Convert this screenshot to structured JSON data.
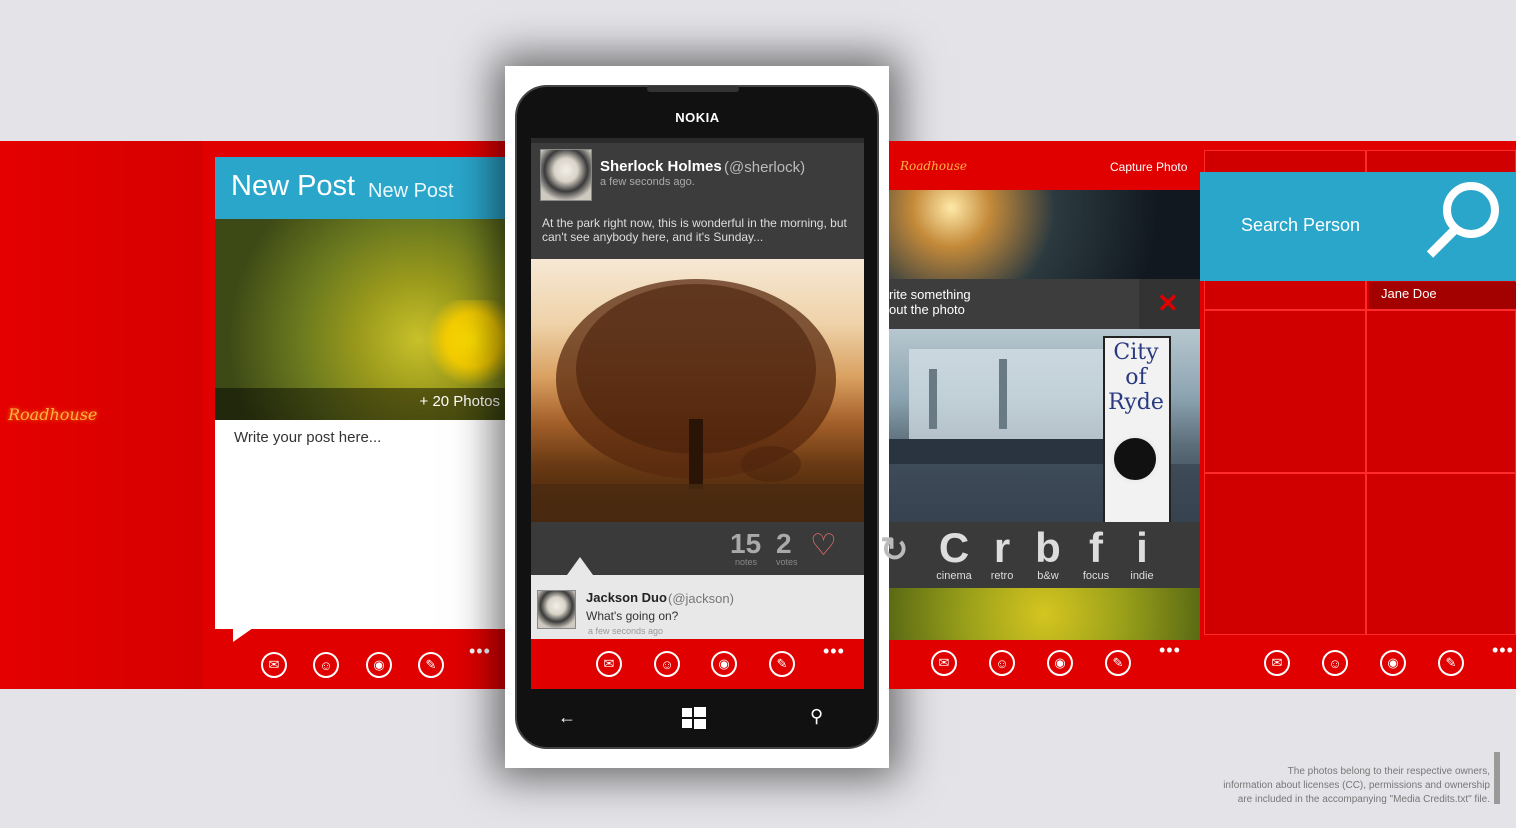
{
  "brand": {
    "logo_text": "Roadhouse",
    "accent_color": "#e00000",
    "secondary_color": "#2aa6cb"
  },
  "new_post": {
    "title": "New Post",
    "subtitle": "New Post",
    "photo_count": "+ 20 Photos",
    "placeholder": "Write your post here..."
  },
  "phone": {
    "brand": "NOKIA",
    "post": {
      "name": "Sherlock Holmes",
      "handle": "(@sherlock)",
      "time": "a few seconds ago.",
      "text": "At the park right now, this is wonderful in the morning, but can't see anybody here, and it's Sunday..."
    },
    "stats": {
      "notes_count": "15",
      "notes_label": "notes",
      "votes_count": "2",
      "votes_label": "votes"
    },
    "comment": {
      "name": "Jackson Duo",
      "handle": "(@jackson)",
      "text": "What's going on?",
      "time": "a few seconds ago"
    }
  },
  "capture": {
    "logo": "Roadhouse",
    "title": "Capture Photo",
    "caption_line1": "rite something",
    "caption_line2": "out the photo",
    "sign_text": "City of Ryde",
    "filters": [
      {
        "letter": "C",
        "label": "cinema"
      },
      {
        "letter": "r",
        "label": "retro"
      },
      {
        "letter": "b",
        "label": "b&w"
      },
      {
        "letter": "f",
        "label": "focus"
      },
      {
        "letter": "i",
        "label": "indie"
      }
    ]
  },
  "search": {
    "label": "Search Person",
    "result": "Jane Doe"
  },
  "appbar": {
    "icons": [
      "mail-icon",
      "people-icon",
      "camera-icon",
      "edit-icon"
    ],
    "more": "•••"
  },
  "credits": {
    "line1": "The photos belong to their respective owners,",
    "line2": "information about licenses (CC), permissions and ownership",
    "line3": "are included in the accompanying \"Media Credits.txt\" file."
  }
}
